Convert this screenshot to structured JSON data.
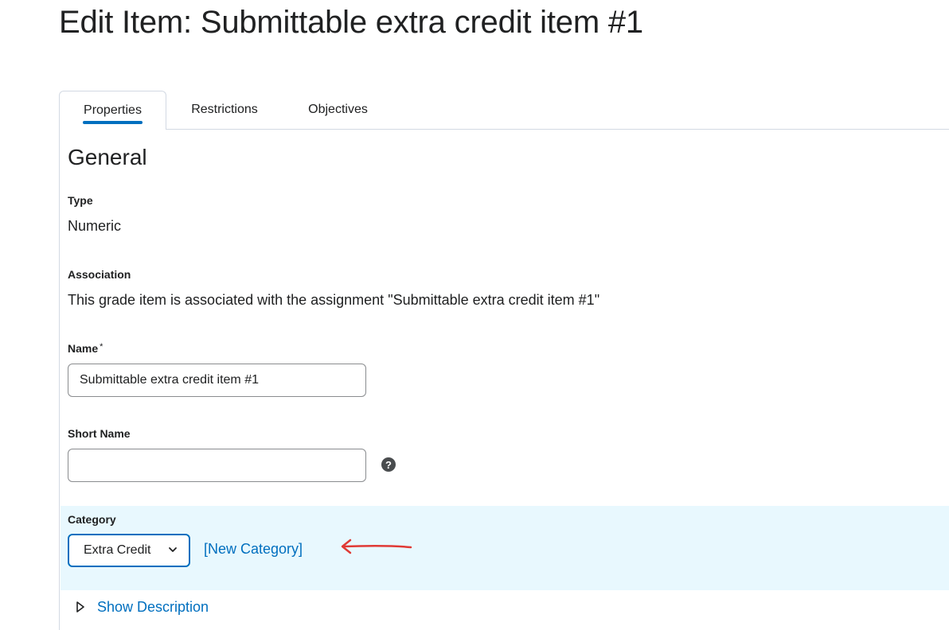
{
  "page": {
    "title": "Edit Item: Submittable extra credit item #1"
  },
  "tabs": [
    {
      "label": "Properties",
      "active": true
    },
    {
      "label": "Restrictions",
      "active": false
    },
    {
      "label": "Objectives",
      "active": false
    }
  ],
  "general": {
    "heading": "General",
    "type_label": "Type",
    "type_value": "Numeric",
    "association_label": "Association",
    "association_value": "This grade item is associated with the assignment \"Submittable extra credit item #1\"",
    "name_label": "Name",
    "name_required_mark": "*",
    "name_value": "Submittable extra credit item #1",
    "short_name_label": "Short Name",
    "short_name_value": "",
    "help_icon_glyph": "?"
  },
  "category": {
    "label": "Category",
    "selected": "Extra Credit",
    "new_category_link": "[New Category]"
  },
  "description": {
    "toggle_label": "Show Description"
  },
  "colors": {
    "accent": "#006fbf",
    "category_band": "#e8f8fe",
    "annotation_arrow": "#e03a35"
  }
}
